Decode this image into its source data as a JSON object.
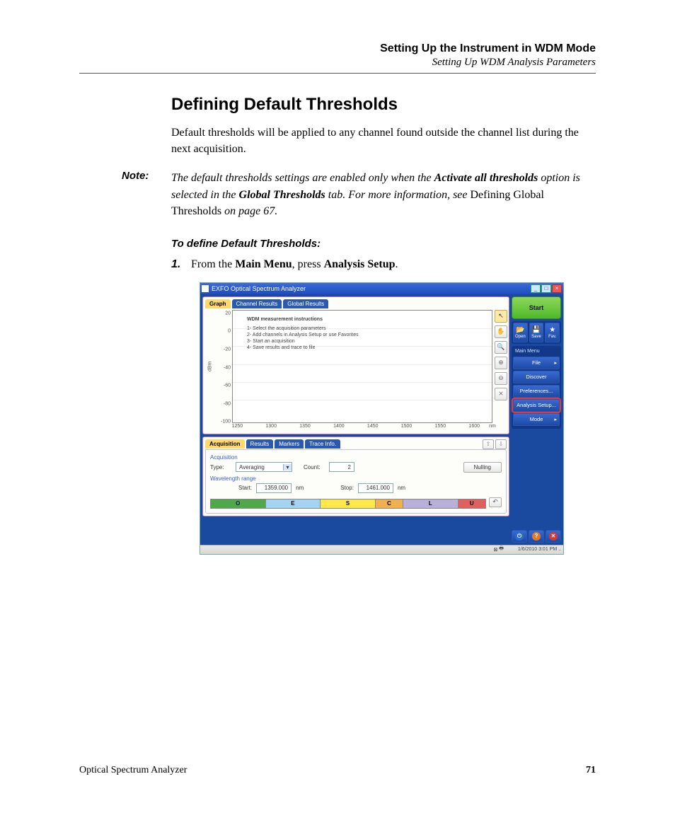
{
  "header": {
    "chapter": "Setting Up the Instrument in WDM Mode",
    "section": "Setting Up WDM Analysis Parameters"
  },
  "heading": "Defining Default Thresholds",
  "intro": "Default thresholds will be applied to any channel found outside the channel list during the next acquisition.",
  "note": {
    "label": "Note:",
    "t1": "The default thresholds settings are enabled only when the ",
    "b1": "Activate all thresholds",
    "t2": " option is selected in the ",
    "b2": "Global Thresholds",
    "t3": " tab. For more information, see ",
    "up": "Defining Global Thresholds",
    "t4": " on page 67."
  },
  "procedure": {
    "title": "To define Default Thresholds:",
    "step_num": "1.",
    "step_t1": "From the ",
    "step_b1": "Main Menu",
    "step_t2": ", press ",
    "step_b2": "Analysis Setup",
    "step_t3": "."
  },
  "screenshot": {
    "title": "EXFO Optical Spectrum Analyzer",
    "tabs_top": {
      "graph": "Graph",
      "ch": "Channel Results",
      "gl": "Global Results"
    },
    "yunit": "dBm",
    "yticks": [
      "20",
      "0",
      "-20",
      "-40",
      "-60",
      "-80",
      "-100"
    ],
    "xticks": [
      "1250",
      "1300",
      "1350",
      "1400",
      "1450",
      "1500",
      "1550",
      "1600"
    ],
    "xunit": "nm",
    "instr": {
      "title": "WDM measurement instructions",
      "l1": "1- Select the acquisition parameters",
      "l2": "2- Add channels in Analysis Setup or use Favorites",
      "l3": "3- Start an acquisition",
      "l4": "4- Save results and trace to file"
    },
    "tools": {
      "arrow": "↖",
      "hand": "✋",
      "search": "🔍",
      "zoomin": "⊕",
      "zoomout": "⊖",
      "ruler": "⨯"
    },
    "tabs_bottom": {
      "acq": "Acquisition",
      "res": "Results",
      "mk": "Markers",
      "ti": "Trace Info."
    },
    "acq": {
      "group1": "Acquisition",
      "type_lbl": "Type:",
      "type_val": "Averaging",
      "count_lbl": "Count:",
      "count_val": "2",
      "nulling": "Nulling",
      "group2": "Wavelength range",
      "start_lbl": "Start:",
      "start_val": "1359.000",
      "stop_lbl": "Stop:",
      "stop_val": "1461.000",
      "unit": "nm",
      "undo": "↶"
    },
    "bands": {
      "o": "O",
      "e": "E",
      "s": "S",
      "c": "C",
      "l": "L",
      "u": "U"
    },
    "right": {
      "start": "Start",
      "open": "Open",
      "save": "Save",
      "fav": "Fav.",
      "menu_hdr": "Main Menu",
      "file": "File",
      "discover": "Discover",
      "prefs": "Preferences...",
      "analysis": "Analysis Setup...",
      "mode": "Mode"
    },
    "status": {
      "left1": "⊠",
      "left2": "🖶",
      "time": "1/6/2010 3:01 PM"
    }
  },
  "footer": {
    "product": "Optical Spectrum Analyzer",
    "page": "71"
  }
}
